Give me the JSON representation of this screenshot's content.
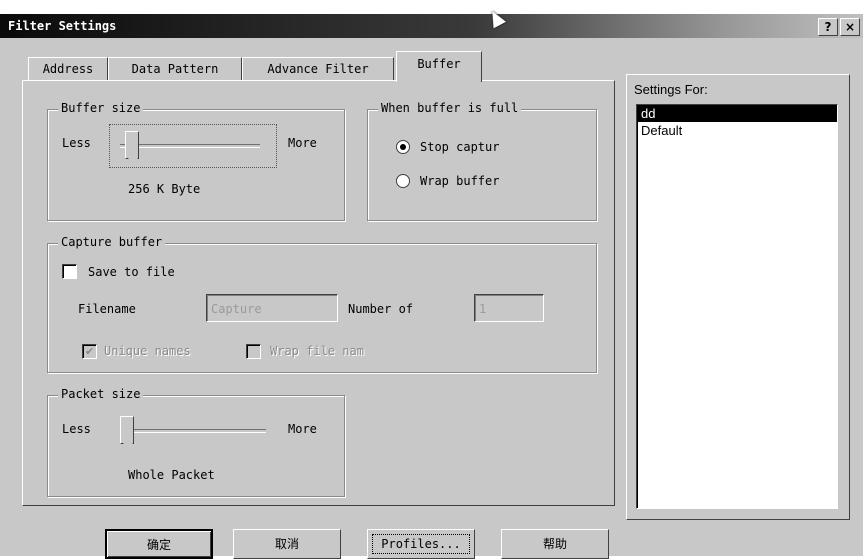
{
  "window": {
    "title": "Filter Settings",
    "help_button": "?",
    "close_button": "×"
  },
  "tabs": [
    {
      "label": "Address",
      "active": false
    },
    {
      "label": "Data Pattern",
      "active": false
    },
    {
      "label": "Advance Filter",
      "active": false
    },
    {
      "label": "Buffer",
      "active": true
    }
  ],
  "buffer_size": {
    "legend": "Buffer size",
    "less_label": "Less",
    "more_label": "More",
    "value_text": "256 K Byte",
    "slider_level": 0.05
  },
  "when_full": {
    "legend": "When buffer is full",
    "options": [
      {
        "label": "Stop captur",
        "selected": true
      },
      {
        "label": "Wrap buffer",
        "selected": false
      }
    ]
  },
  "capture_buffer": {
    "legend": "Capture buffer",
    "save_to_file": {
      "label": "Save to file",
      "checked": false
    },
    "filename_label": "Filename",
    "filename_value": "Capture",
    "number_of_label": "Number of",
    "number_of_value": "1",
    "unique_names": {
      "label": "Unique names",
      "checked": true,
      "enabled": false
    },
    "wrap_file_names": {
      "label": "Wrap file nam",
      "checked": false,
      "enabled": false
    }
  },
  "packet_size": {
    "legend": "Packet size",
    "less_label": "Less",
    "more_label": "More",
    "value_text": "Whole Packet",
    "slider_level": 0.0
  },
  "settings_for": {
    "label": "Settings For:",
    "items": [
      {
        "label": "dd",
        "selected": true
      },
      {
        "label": "Default",
        "selected": false
      }
    ]
  },
  "buttons": {
    "ok": "确定",
    "cancel": "取消",
    "profiles": "Profiles...",
    "help": "帮助"
  }
}
